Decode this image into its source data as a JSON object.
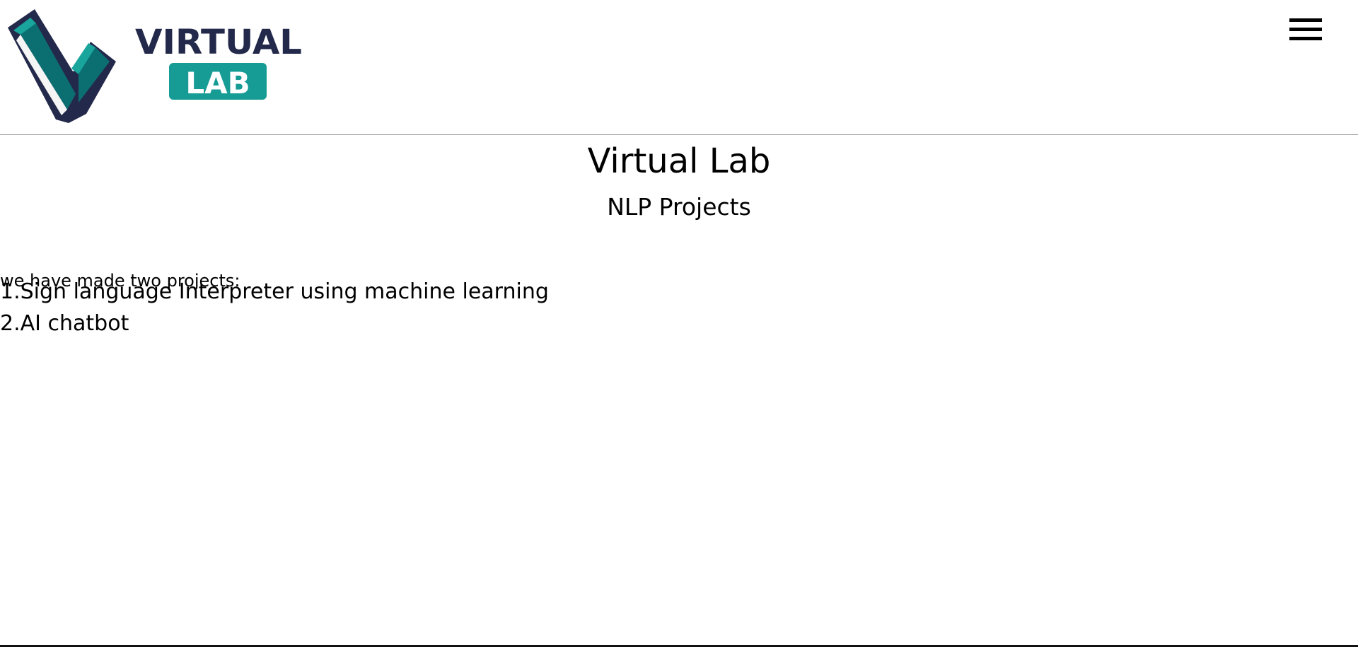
{
  "header": {
    "logo": {
      "wordmark_top": "VIRTUAL",
      "wordmark_bottom": "LAB",
      "colors": {
        "navy": "#23294a",
        "teal": "#169c95",
        "teal_dark": "#0b6f72",
        "white": "#ffffff"
      }
    },
    "menu_icon": "hamburger-icon"
  },
  "main": {
    "title": "Virtual Lab",
    "subtitle": "NLP Projects",
    "intro": "we have made two projects:",
    "projects": [
      "1.Sign language Interpreter using machine learning",
      "2.AI chatbot"
    ]
  }
}
